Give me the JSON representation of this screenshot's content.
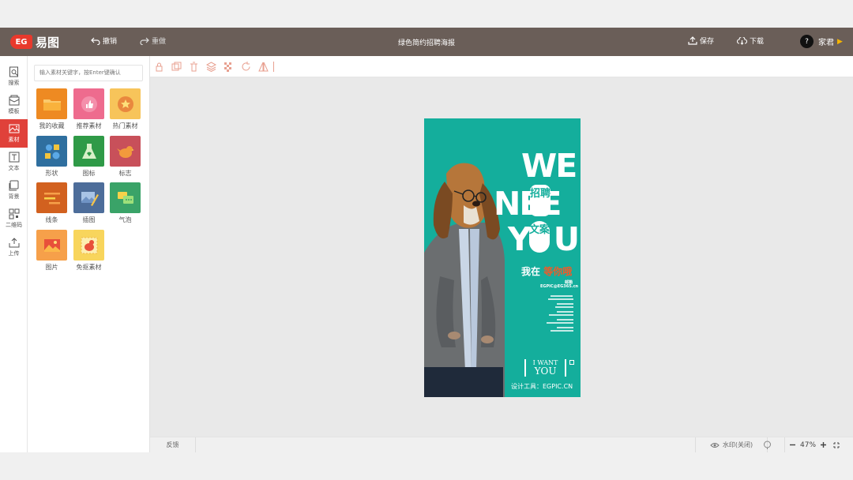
{
  "app": {
    "logo_mark": "EG",
    "logo_text": "易图",
    "document_title": "绿色简约招聘海报"
  },
  "header": {
    "undo_label": "撤销",
    "redo_label": "重做",
    "save_label": "保存",
    "download_label": "下载",
    "user_name": "家君"
  },
  "rail": {
    "items": [
      {
        "label": "搜索",
        "icon": "search-icon"
      },
      {
        "label": "模板",
        "icon": "template-icon"
      },
      {
        "label": "素材",
        "icon": "image-icon",
        "active": true
      },
      {
        "label": "文本",
        "icon": "text-icon"
      },
      {
        "label": "背景",
        "icon": "background-icon"
      },
      {
        "label": "二维码",
        "icon": "qrcode-icon"
      },
      {
        "label": "上传",
        "icon": "upload-icon"
      }
    ]
  },
  "panel": {
    "search_placeholder": "输入素材关键字，按Enter键确认",
    "tiles": [
      {
        "label": "我的收藏",
        "color": "#ee8a22",
        "icon": "folder-icon"
      },
      {
        "label": "推荐素材",
        "color": "#ee6b8e",
        "icon": "thumbs-up-icon"
      },
      {
        "label": "热门素材",
        "color": "#f7c45a",
        "icon": "star-icon"
      },
      {
        "label": "形状",
        "color": "#2f6f9f",
        "icon": "shapes-icon"
      },
      {
        "label": "图标",
        "color": "#2f9a47",
        "icon": "flask-icon"
      },
      {
        "label": "标志",
        "color": "#c8505a",
        "icon": "bird-icon"
      },
      {
        "label": "线条",
        "color": "#d2611f",
        "icon": "lines-icon"
      },
      {
        "label": "插图",
        "color": "#4d6d9a",
        "icon": "picture-pen-icon"
      },
      {
        "label": "气泡",
        "color": "#3aa368",
        "icon": "bubble-icon"
      },
      {
        "label": "图片",
        "color": "#f6a04a",
        "icon": "photo-icon"
      },
      {
        "label": "免抠素材",
        "color": "#f8d55c",
        "icon": "cutout-icon"
      }
    ]
  },
  "poster": {
    "line1": "WE",
    "line2": "NEE",
    "line3": "Y",
    "line3b": "U",
    "tag1": "招聘",
    "tag2": "文案",
    "slogan_prefix": "我在",
    "slogan_highlight": "等你哦",
    "contact_name": "邮箱",
    "email": "EGPIC@EG365.cn",
    "iwant_line1": "I WANT",
    "iwant_line2": "YOU",
    "tool_credit": "设计工具：EGPIC.CN",
    "colors": {
      "background": "#14ae9c",
      "highlight": "#f05a28"
    }
  },
  "status": {
    "feedback_label": "反馈",
    "watermark_label": "水印(关闭)",
    "zoom_level": "47%"
  }
}
